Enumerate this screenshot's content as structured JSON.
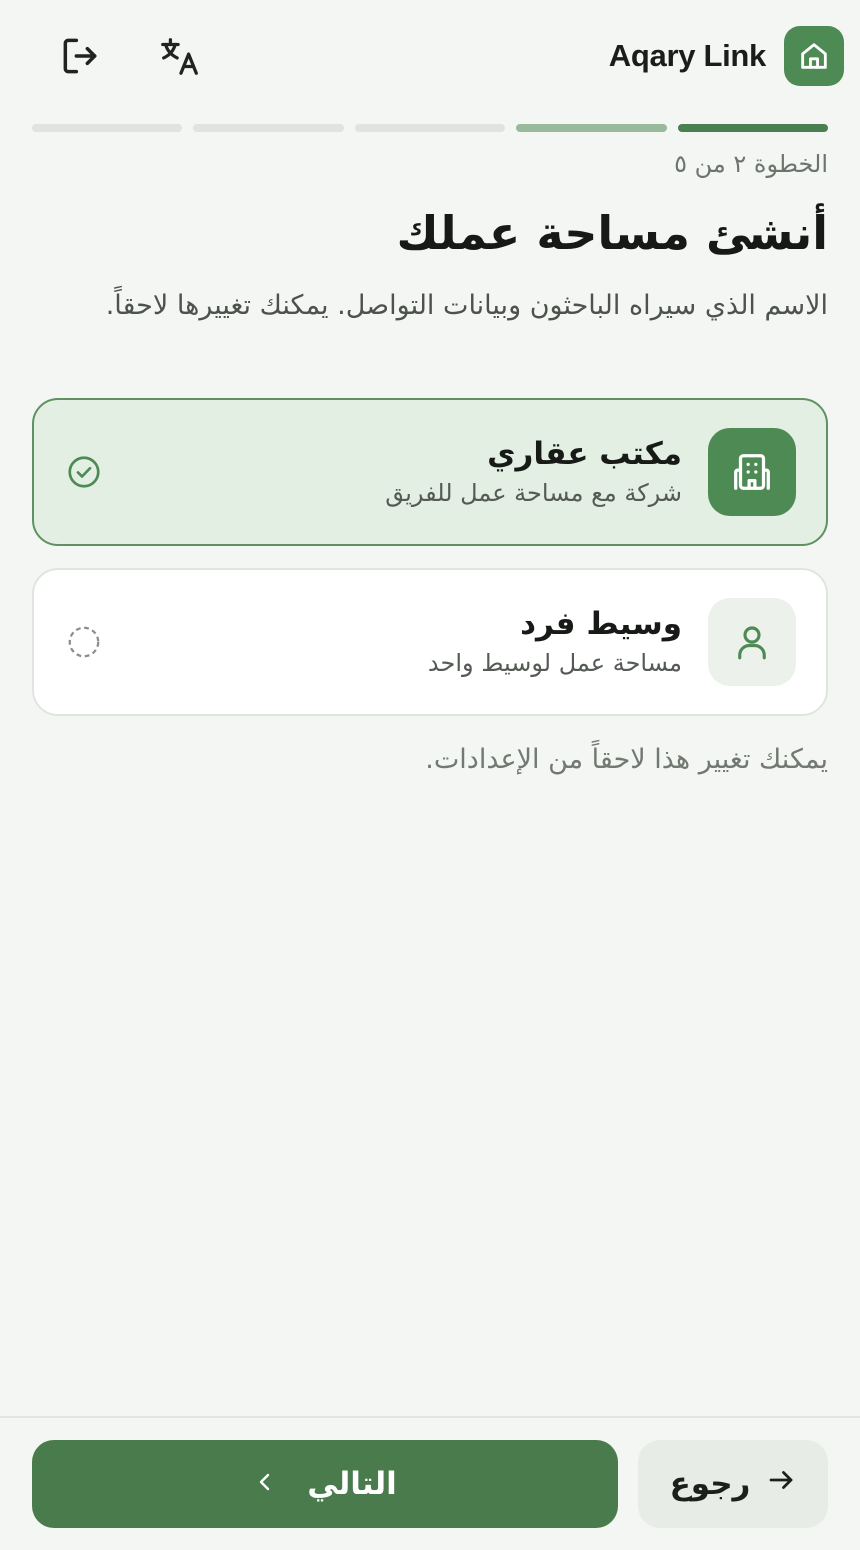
{
  "header": {
    "brand": "Aqary Link",
    "icons": {
      "logo": "home-icon",
      "translate": "translate-icon",
      "logout": "logout-icon"
    }
  },
  "progress": {
    "total_steps": 5,
    "current_step": 2
  },
  "step_label": "الخطوة ٢ من ٥",
  "title": "أنشئ مساحة عملك",
  "description": "الاسم الذي سيراه الباحثون وبيانات التواصل. يمكنك تغييرها لاحقاً.",
  "options": [
    {
      "title": "مكتب عقاري",
      "subtitle": "شركة مع مساحة عمل للفريق",
      "icon": "building-icon",
      "selected": true
    },
    {
      "title": "وسيط فرد",
      "subtitle": "مساحة عمل لوسيط واحد",
      "icon": "user-icon",
      "selected": false
    }
  ],
  "note": "يمكنك تغيير هذا لاحقاً من الإعدادات.",
  "footer": {
    "back_label": "رجوع",
    "next_label": "التالي"
  },
  "colors": {
    "accent": "#4a7b4d",
    "accent_light": "#e3efe2",
    "background": "#f4f6f3"
  }
}
